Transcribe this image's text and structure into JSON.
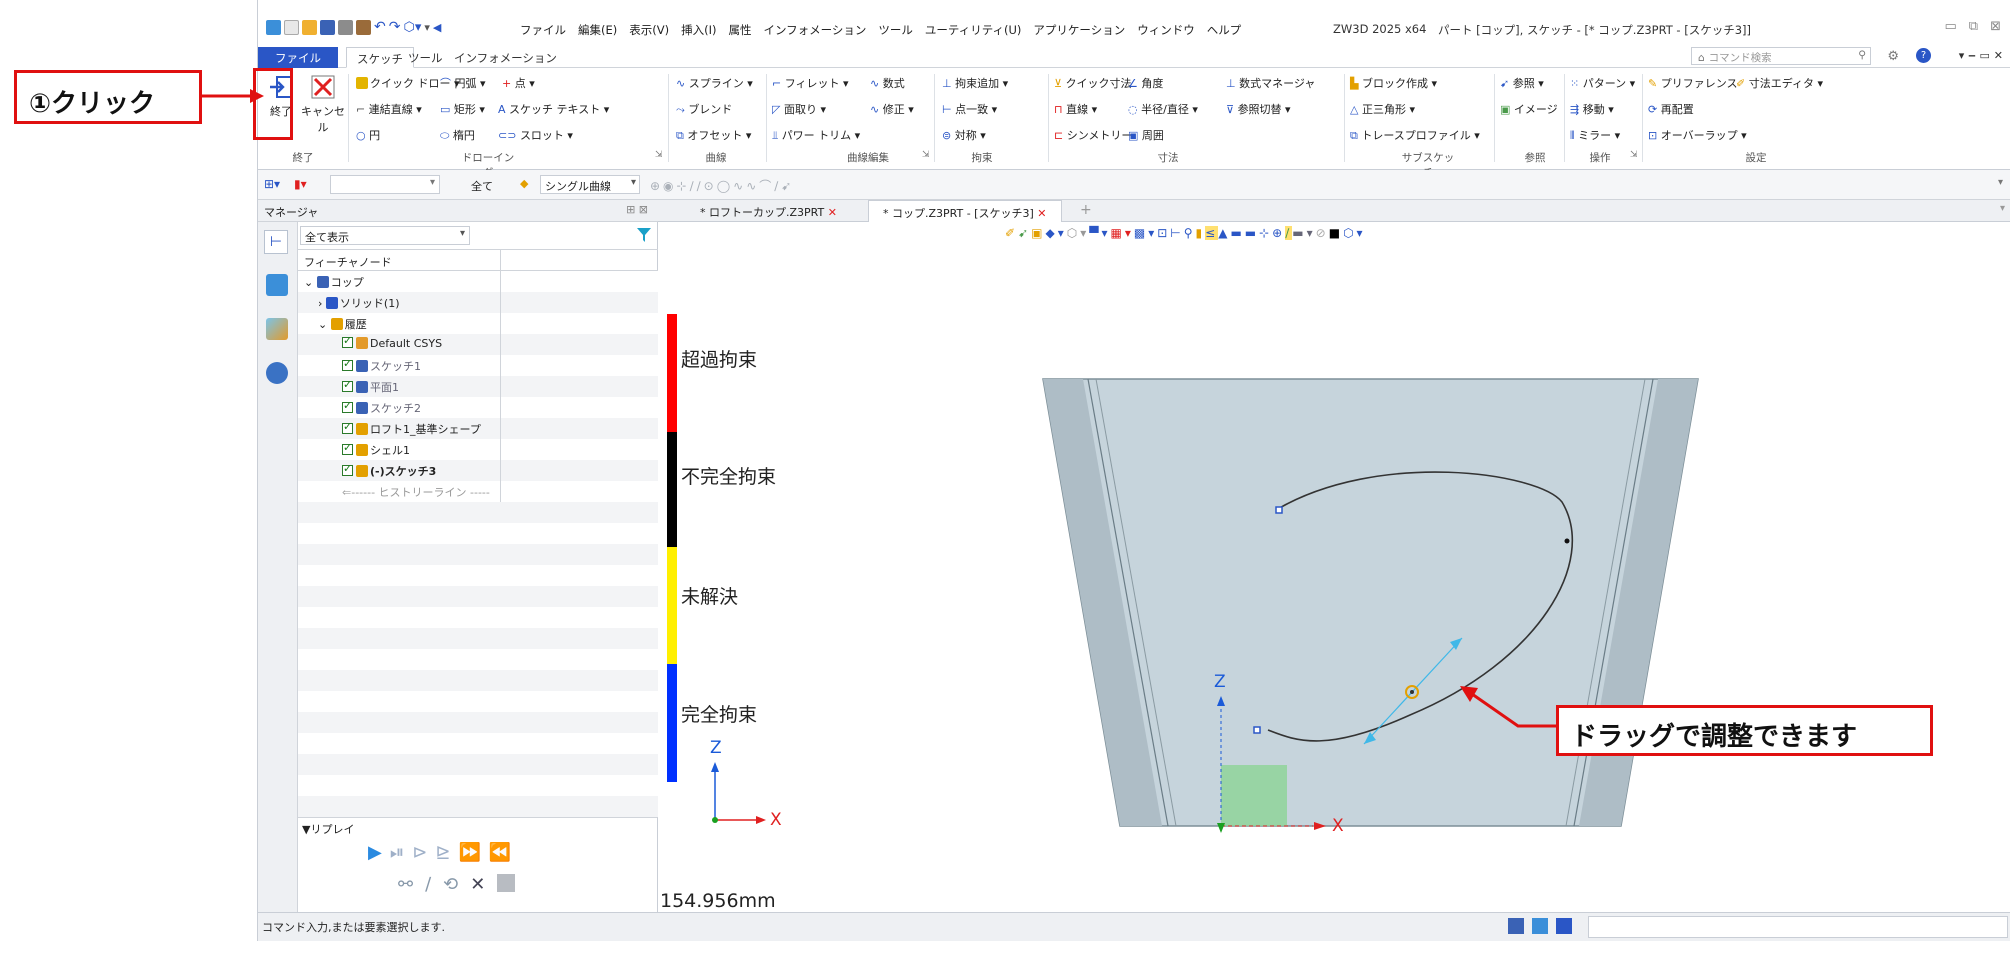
{
  "title_bar": {
    "menu": [
      "ファイル",
      "編集(E)",
      "表示(V)",
      "挿入(I)",
      "属性",
      "インフォメーション",
      "ツール",
      "ユーティリティ(U)",
      "アプリケーション",
      "ウィンドウ",
      "ヘルプ"
    ],
    "app": "ZW3D 2025 x64",
    "doc": "パート [コップ], スケッチ - [* コップ.Z3PRT - [スケッチ3]]"
  },
  "ribbon_tabs": {
    "file": "ファイル(F)",
    "tabs": [
      "スケッチ",
      "ツール",
      "インフォメーション"
    ],
    "search_placeholder": "コマンド検索"
  },
  "ribbon": {
    "finish": {
      "exit": "終了",
      "cancel": "キャンセル",
      "group": "終了"
    },
    "drawing": {
      "quick_draw": "クイック ドロー",
      "arc": "円弧",
      "point": "点",
      "polyline": "連結直線",
      "rect": "矩形",
      "sketch_text": "スケッチ テキスト",
      "circle": "円",
      "ellipse": "楕円",
      "slot": "スロット",
      "group": "ドローイング"
    },
    "curve": {
      "spline": "スプライン",
      "blend": "ブレンド",
      "offset": "オフセット",
      "group": "曲線"
    },
    "curve_edit": {
      "fillet": "フィレット",
      "chamfer": "面取り",
      "power_trim": "パワー トリム",
      "formula": "数式",
      "modify": "修正",
      "group": "曲線編集"
    },
    "constraint": {
      "add": "拘束追加",
      "point_coincident": "点一致",
      "symmetric": "対称",
      "group": "拘束"
    },
    "dimension": {
      "quick": "クイック寸法",
      "angle": "角度",
      "linear": "直線",
      "radius": "半径/直径",
      "symmetry": "シンメトリー",
      "perimeter": "周囲",
      "formula_mgr": "数式マネージャ",
      "ref_switch": "参照切替",
      "group": "寸法"
    },
    "subsketch": {
      "block": "ブロック作成",
      "triangle": "正三角形",
      "trace": "トレースプロファイル",
      "group": "サブスケッチ"
    },
    "reference": {
      "ref": "参照",
      "image": "イメージ",
      "group": "参照"
    },
    "operation": {
      "pattern": "パターン",
      "move": "移動",
      "mirror": "ミラー",
      "group": "操作"
    },
    "settings": {
      "preference": "プリファレンス",
      "dim_editor": "寸法エディタ",
      "rearrange": "再配置",
      "overlap": "オーバーラップ",
      "group": "設定"
    }
  },
  "toolbar2": {
    "all": "全て",
    "filter": "シングル曲線"
  },
  "manager": {
    "title": "マネージャ",
    "show_all": "全て表示",
    "column": "フィーチャノード",
    "nodes": [
      {
        "label": "コップ",
        "level": 0,
        "check": false
      },
      {
        "label": "ソリッド(1)",
        "level": 1,
        "check": false
      },
      {
        "label": "履歴",
        "level": 1,
        "check": false
      },
      {
        "label": "Default CSYS",
        "level": 2,
        "check": true
      },
      {
        "label": "スケッチ1",
        "level": 2,
        "check": true
      },
      {
        "label": "平面1",
        "level": 2,
        "check": true
      },
      {
        "label": "スケッチ2",
        "level": 2,
        "check": true
      },
      {
        "label": "ロフト1_基準シェープ",
        "level": 2,
        "check": true
      },
      {
        "label": "シェル1",
        "level": 2,
        "check": true
      },
      {
        "label": "(-)スケッチ3",
        "level": 2,
        "check": true
      },
      {
        "label": "------ ヒストリーライン -----",
        "level": 2,
        "check": false
      }
    ],
    "replay": "▼リプレイ"
  },
  "doc_tabs": [
    "* ロフトーカップ.Z3PRT",
    "* コップ.Z3PRT - [スケッチ3]"
  ],
  "legend": {
    "items": [
      {
        "label": "超過拘束",
        "color": "#ff0000"
      },
      {
        "label": "不完全拘束",
        "color": "#000000"
      },
      {
        "label": "未解決",
        "color": "#ffef00"
      },
      {
        "label": "完全拘束",
        "color": "#0030ff"
      }
    ]
  },
  "axes": {
    "x": "X",
    "z": "Z"
  },
  "measure": "154.956mm",
  "status": "コマンド入力,または要素選択します.",
  "callouts": {
    "click": "①クリック",
    "drag": "ドラッグで調整できます"
  }
}
